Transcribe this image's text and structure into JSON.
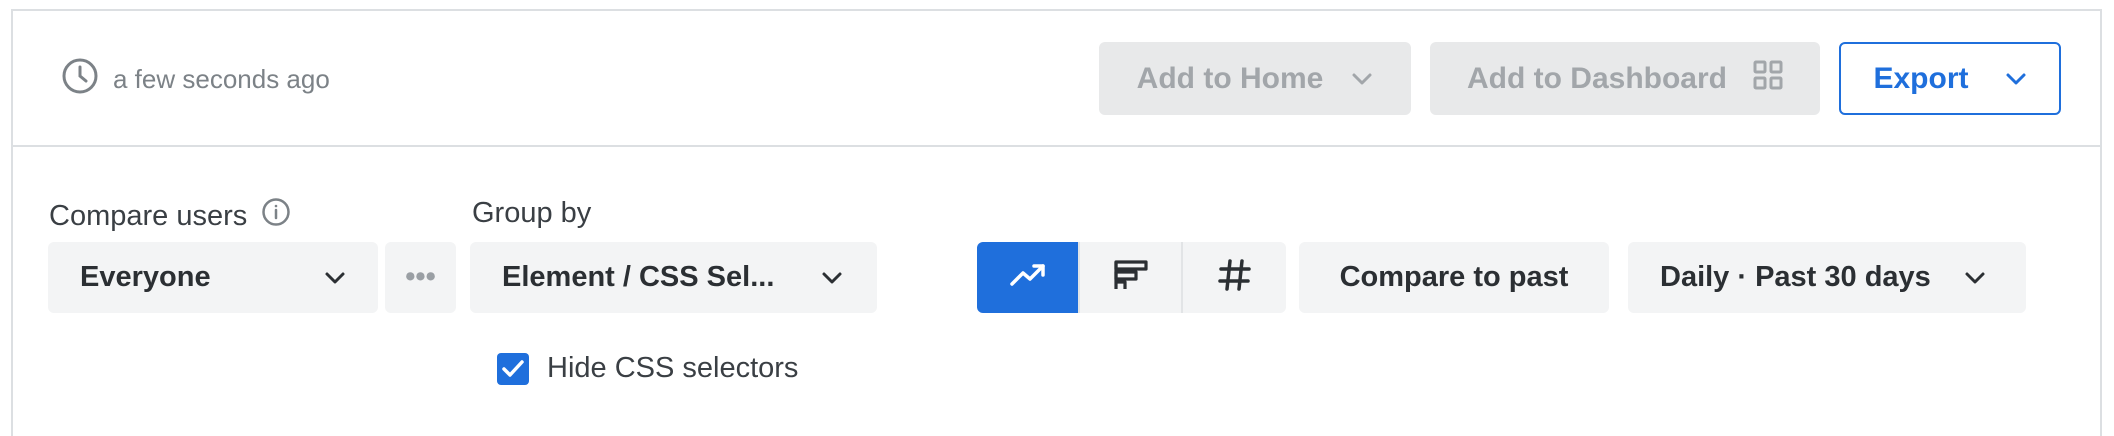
{
  "header": {
    "timestamp": "a few seconds ago",
    "add_to_home_label": "Add to Home",
    "add_to_dashboard_label": "Add to Dashboard",
    "export_label": "Export"
  },
  "controls": {
    "compare_users_label": "Compare users",
    "compare_users_value": "Everyone",
    "more_label": "•••",
    "group_by_label": "Group by",
    "group_by_value": "Element / CSS Sel...",
    "hide_css_label": "Hide CSS selectors",
    "hide_css_checked": true,
    "compare_to_past_label": "Compare to past",
    "date_range_value": "Daily · Past 30 days",
    "viz_options": [
      "line-chart-icon",
      "bar-chart-icon",
      "number-icon"
    ],
    "viz_selected": "line-chart-icon"
  },
  "colors": {
    "accent": "#1f6fdc",
    "disabled_bg": "#e8e9ea",
    "select_bg": "#f3f4f5"
  }
}
